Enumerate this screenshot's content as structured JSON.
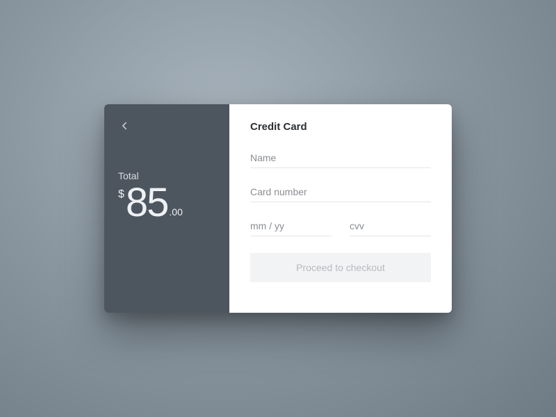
{
  "summary": {
    "total_label": "Total",
    "currency_symbol": "$",
    "amount_int": "85",
    "amount_dec": ".00"
  },
  "form": {
    "title": "Credit Card",
    "name_placeholder": "Name",
    "card_number_placeholder": "Card number",
    "expiry_placeholder": "mm / yy",
    "cvv_placeholder": "cvv",
    "submit_label": "Proceed to checkout"
  }
}
